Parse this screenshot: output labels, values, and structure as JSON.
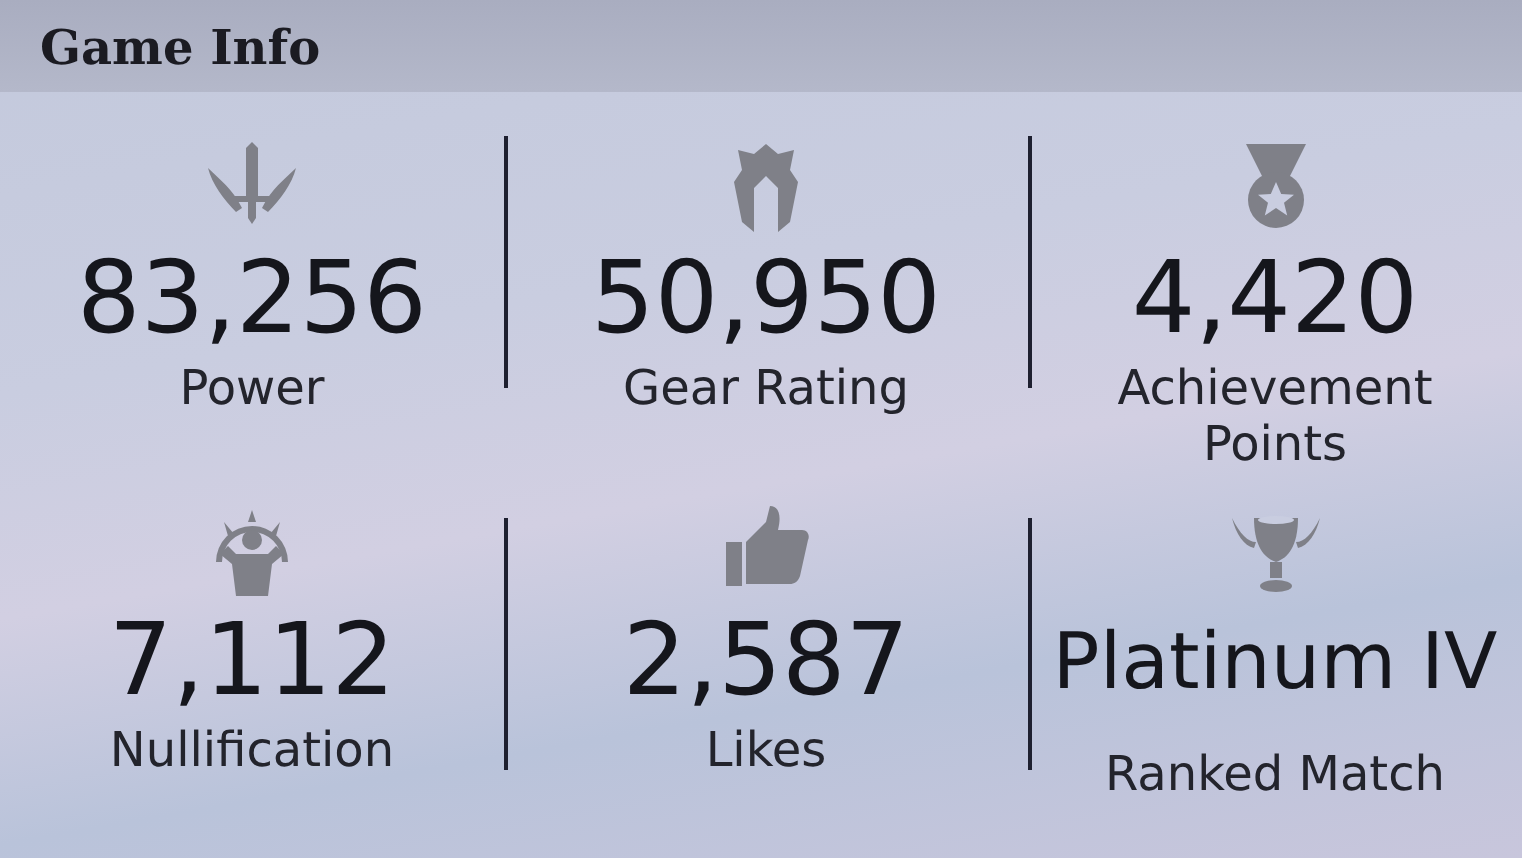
{
  "header": {
    "title": "Game Info"
  },
  "stats": [
    {
      "value": "83,256",
      "label": "Power"
    },
    {
      "value": "50,950",
      "label": "Gear Rating"
    },
    {
      "value": "4,420",
      "label": "Achievement Points"
    },
    {
      "value": "7,112",
      "label": "Nullification"
    },
    {
      "value": "2,587",
      "label": "Likes"
    },
    {
      "value": "Platinum IV",
      "label": "Ranked Match"
    }
  ]
}
